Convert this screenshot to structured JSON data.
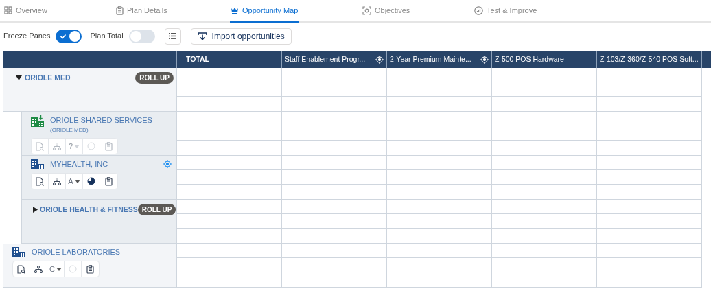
{
  "tabs": [
    {
      "label": "Overview",
      "selected": false
    },
    {
      "label": "Plan Details",
      "selected": false
    },
    {
      "label": "Opportunity Map",
      "selected": true
    },
    {
      "label": "Objectives",
      "selected": false
    },
    {
      "label": "Test & Improve",
      "selected": false
    }
  ],
  "toolbar": {
    "toggles": [
      {
        "label": "Freeze Panes",
        "on": true
      },
      {
        "label": "Plan Total",
        "on": false
      }
    ],
    "import_button": "Import opportunities"
  },
  "table": {
    "columns": [
      {
        "label": "TOTAL",
        "kind": "total",
        "targeted": false
      },
      {
        "label": "Staff Enablement Progr...",
        "kind": "product",
        "targeted": true
      },
      {
        "label": "2-Year Premium Mainte...",
        "kind": "product",
        "targeted": true
      },
      {
        "label": "Z-500 POS Hardware",
        "kind": "product",
        "targeted": false
      },
      {
        "label": "Z-103/Z-360/Z-540 POS Soft...",
        "kind": "product",
        "targeted": false
      }
    ],
    "accounts": [
      {
        "kind": "group",
        "name": "ORIOLE MED",
        "expanded": true,
        "badge": "ROLL UP",
        "children": [
          {
            "kind": "account",
            "name": "ORIOLE SHARED SERVICES",
            "sublabel": "(ORIOLE MED)",
            "linked": true,
            "targeted": false,
            "tools": {
              "disabled": true,
              "grade": "?"
            }
          },
          {
            "kind": "account",
            "name": "MYHEALTH, INC",
            "linked": false,
            "targeted": true,
            "tools": {
              "disabled": false,
              "grade": "A",
              "level": 0.75
            }
          },
          {
            "kind": "group",
            "name": "ORIOLE HEALTH & FITNESS",
            "expanded": false,
            "badge": "ROLL UP"
          }
        ]
      },
      {
        "kind": "account",
        "name": "ORIOLE LABORATORIES",
        "linked": false,
        "targeted": false,
        "tools": {
          "disabled": false,
          "grade": "C"
        }
      }
    ]
  }
}
